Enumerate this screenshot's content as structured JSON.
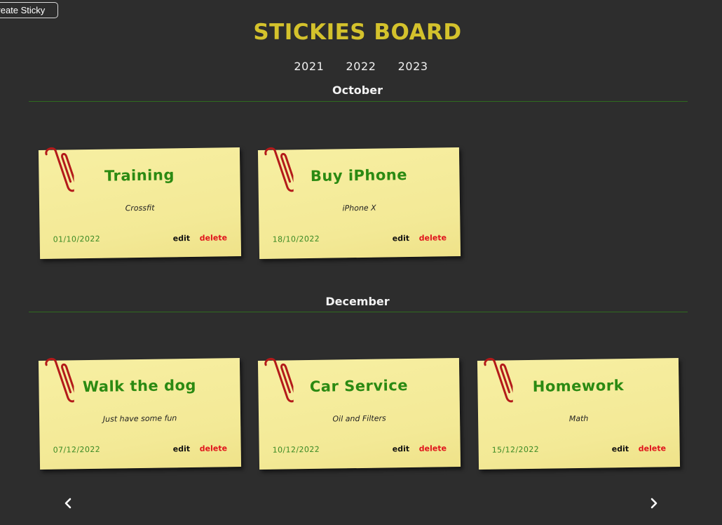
{
  "header": {
    "create_label": "Create Sticky",
    "title": "STICKIES BOARD"
  },
  "years": [
    "2021",
    "2022",
    "2023"
  ],
  "sections": [
    {
      "month": "October",
      "stickies": [
        {
          "title": "Training",
          "description": "Crossfit",
          "date": "01/10/2022",
          "edit": "edit",
          "delete": "delete"
        },
        {
          "title": "Buy iPhone",
          "description": "iPhone X",
          "date": "18/10/2022",
          "edit": "edit",
          "delete": "delete"
        }
      ]
    },
    {
      "month": "December",
      "stickies": [
        {
          "title": "Walk the dog",
          "description": "Just have some fun",
          "date": "07/12/2022",
          "edit": "edit",
          "delete": "delete"
        },
        {
          "title": "Car Service",
          "description": "Oil and Filters",
          "date": "10/12/2022",
          "edit": "edit",
          "delete": "delete"
        },
        {
          "title": "Homework",
          "description": "Math",
          "date": "15/12/2022",
          "edit": "edit",
          "delete": "delete"
        }
      ]
    }
  ],
  "colors": {
    "background": "#2d2d2d",
    "title_accent": "#d4c22c",
    "sticky_paper": "#f4eb98",
    "sticky_title": "#2b8a12",
    "delete_link": "#e0141c",
    "divider": "#2f6b1f"
  },
  "icons": {
    "paperclip": "paperclip-icon",
    "prev": "chevron-left-icon",
    "next": "chevron-right-icon"
  }
}
